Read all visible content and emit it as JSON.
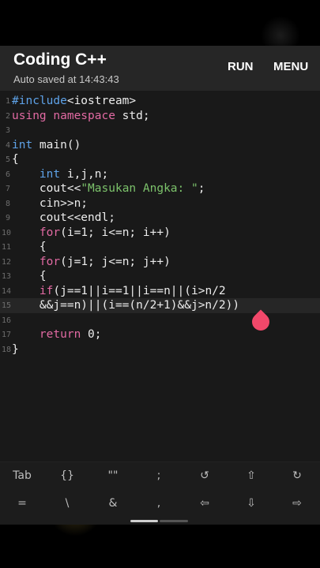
{
  "header": {
    "title": "Coding C++",
    "autosave": "Auto saved at 14:43:43",
    "run_label": "RUN",
    "menu_label": "MENU"
  },
  "editor": {
    "current_line": 15,
    "lines": [
      {
        "n": "1",
        "parts": [
          {
            "t": "#include",
            "c": "kwb"
          },
          {
            "t": "<iostream>",
            "c": ""
          }
        ]
      },
      {
        "n": "2",
        "parts": [
          {
            "t": "using namespace",
            "c": "kw"
          },
          {
            "t": " std;",
            "c": ""
          }
        ]
      },
      {
        "n": "3",
        "parts": []
      },
      {
        "n": "4",
        "parts": [
          {
            "t": "int",
            "c": "kwb"
          },
          {
            "t": " main()",
            "c": ""
          }
        ]
      },
      {
        "n": "5",
        "parts": [
          {
            "t": "{",
            "c": ""
          }
        ]
      },
      {
        "n": "6",
        "parts": [
          {
            "t": "    ",
            "c": ""
          },
          {
            "t": "int",
            "c": "kwb"
          },
          {
            "t": " i,j,n;",
            "c": ""
          }
        ]
      },
      {
        "n": "7",
        "parts": [
          {
            "t": "    cout<<",
            "c": ""
          },
          {
            "t": "\"Masukan Angka: \"",
            "c": "str"
          },
          {
            "t": ";",
            "c": ""
          }
        ]
      },
      {
        "n": "8",
        "parts": [
          {
            "t": "    cin>>n;",
            "c": ""
          }
        ]
      },
      {
        "n": "9",
        "parts": [
          {
            "t": "    cout<<endl;",
            "c": ""
          }
        ]
      },
      {
        "n": "10",
        "parts": [
          {
            "t": "    ",
            "c": ""
          },
          {
            "t": "for",
            "c": "kw"
          },
          {
            "t": "(i=1; i<=n; i++)",
            "c": ""
          }
        ]
      },
      {
        "n": "11",
        "parts": [
          {
            "t": "    {",
            "c": ""
          }
        ]
      },
      {
        "n": "12",
        "parts": [
          {
            "t": "    ",
            "c": ""
          },
          {
            "t": "for",
            "c": "kw"
          },
          {
            "t": "(j=1; j<=n; j++)",
            "c": ""
          }
        ]
      },
      {
        "n": "13",
        "parts": [
          {
            "t": "    {",
            "c": ""
          }
        ]
      },
      {
        "n": "14",
        "parts": [
          {
            "t": "    ",
            "c": ""
          },
          {
            "t": "if",
            "c": "kw"
          },
          {
            "t": "(j==1||i==1||i==n||(i>n/2",
            "c": ""
          }
        ]
      },
      {
        "n": "15",
        "parts": [
          {
            "t": "    &&j==n)||(i==(n/2+1)&&j>n/2))",
            "c": ""
          }
        ]
      },
      {
        "n": "16",
        "parts": []
      },
      {
        "n": "17",
        "parts": [
          {
            "t": "    ",
            "c": ""
          },
          {
            "t": "return",
            "c": "kw"
          },
          {
            "t": " 0;",
            "c": ""
          }
        ]
      },
      {
        "n": "18",
        "parts": [
          {
            "t": "}",
            "c": ""
          }
        ]
      }
    ]
  },
  "keyboard": {
    "row1": [
      {
        "label": "Tab",
        "name": "tab-key"
      },
      {
        "label": "{}",
        "name": "braces-key"
      },
      {
        "label": "\"\"",
        "name": "quotes-key"
      },
      {
        "label": ";",
        "name": "semicolon-key"
      },
      {
        "label": "↺",
        "name": "undo-icon"
      },
      {
        "label": "⇧",
        "name": "shift-icon"
      },
      {
        "label": "↻",
        "name": "redo-icon"
      }
    ],
    "row2": [
      {
        "label": "=",
        "name": "equals-key"
      },
      {
        "label": "\\",
        "name": "backslash-key"
      },
      {
        "label": "&",
        "name": "ampersand-key"
      },
      {
        "label": ",",
        "name": "comma-key"
      },
      {
        "label": "⇦",
        "name": "arrow-left-icon"
      },
      {
        "label": "⇩",
        "name": "arrow-down-icon"
      },
      {
        "label": "⇨",
        "name": "arrow-right-icon"
      }
    ]
  },
  "colors": {
    "keyword_pink": "#e26aa3",
    "keyword_blue": "#5ea2e8",
    "string_green": "#7cc26b",
    "cursor_handle": "#f2486a"
  }
}
